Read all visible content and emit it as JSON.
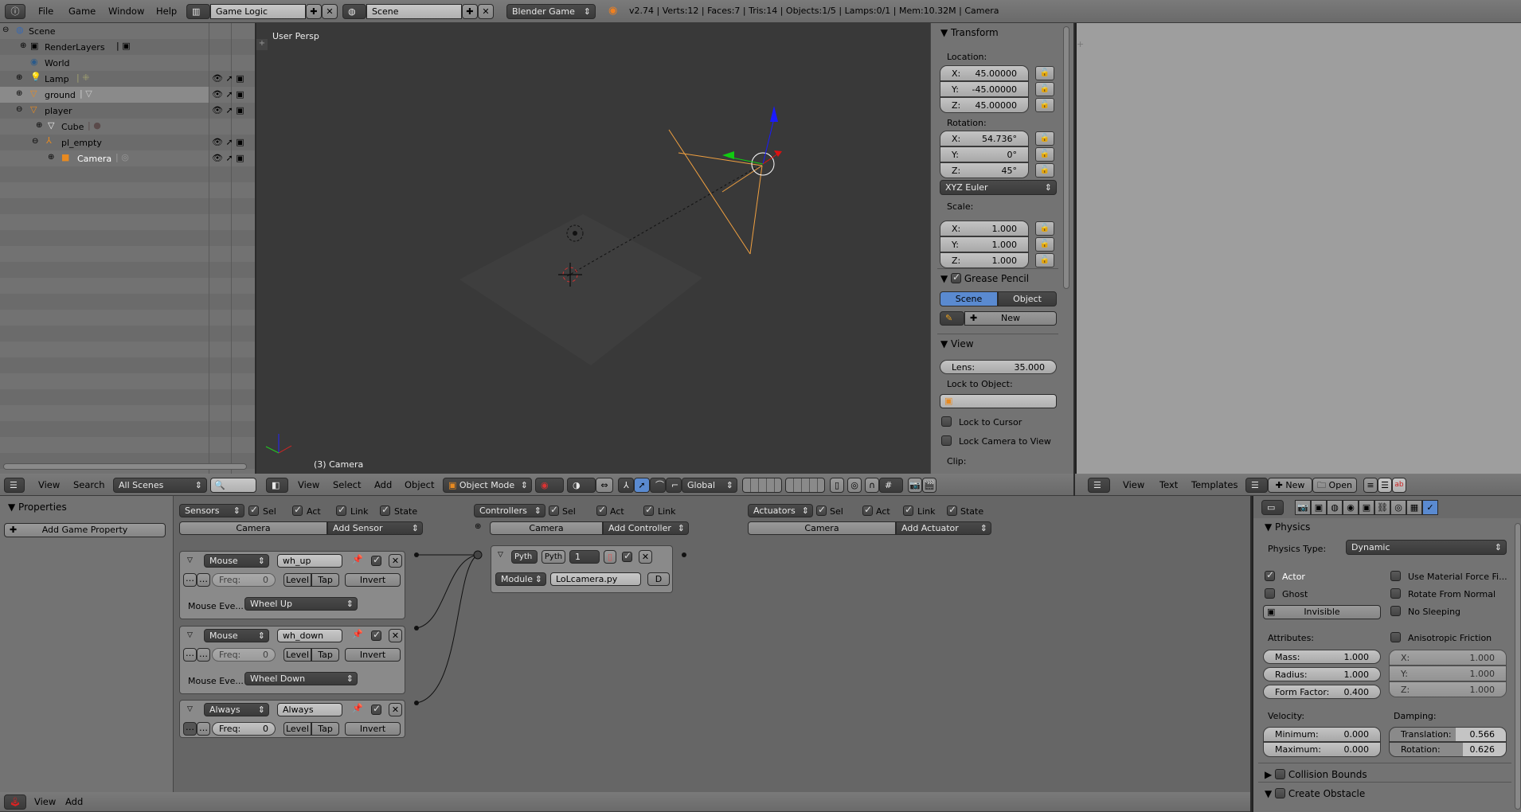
{
  "topbar": {
    "menus": [
      "File",
      "Game",
      "Window",
      "Help"
    ],
    "screen_layout": "Game Logic",
    "scene": "Scene",
    "engine": "Blender Game",
    "stats": "v2.74 | Verts:12 | Faces:7 | Tris:14 | Objects:1/5 | Lamps:0/1 | Mem:10.32M | Camera"
  },
  "outliner": {
    "items": [
      {
        "label": "Scene",
        "icon": "scene-icon"
      },
      {
        "label": "RenderLayers",
        "icon": "renderlayers-icon"
      },
      {
        "label": "World",
        "icon": "world-icon"
      },
      {
        "label": "Lamp",
        "icon": "lamp-icon"
      },
      {
        "label": "ground",
        "icon": "mesh-object-icon"
      },
      {
        "label": "player",
        "icon": "mesh-object-icon"
      },
      {
        "label": "Cube",
        "icon": "mesh-data-icon"
      },
      {
        "label": "pl_empty",
        "icon": "empty-icon"
      },
      {
        "label": "Camera",
        "icon": "camera-icon"
      }
    ],
    "header": {
      "view": "View",
      "search": "Search",
      "filter": "All Scenes"
    }
  },
  "viewport": {
    "label_top": "User Persp",
    "label_bottom": "(3) Camera",
    "header": {
      "view": "View",
      "select": "Select",
      "add": "Add",
      "object": "Object",
      "mode": "Object Mode",
      "orientation": "Global"
    }
  },
  "npanel": {
    "transform": {
      "title": "Transform",
      "location_label": "Location:",
      "location": [
        {
          "axis": "X:",
          "value": "45.00000"
        },
        {
          "axis": "Y:",
          "value": "-45.00000"
        },
        {
          "axis": "Z:",
          "value": "45.00000"
        }
      ],
      "rotation_label": "Rotation:",
      "rotation": [
        {
          "axis": "X:",
          "value": "54.736°"
        },
        {
          "axis": "Y:",
          "value": "0°"
        },
        {
          "axis": "Z:",
          "value": "45°"
        }
      ],
      "rotation_mode": "XYZ Euler",
      "scale_label": "Scale:",
      "scale": [
        {
          "axis": "X:",
          "value": "1.000"
        },
        {
          "axis": "Y:",
          "value": "1.000"
        },
        {
          "axis": "Z:",
          "value": "1.000"
        }
      ]
    },
    "grease_pencil": {
      "title": "Grease Pencil",
      "scene": "Scene",
      "object": "Object",
      "new": "New"
    },
    "view": {
      "title": "View",
      "lens_label": "Lens:",
      "lens": "35.000",
      "lock_to_object": "Lock to Object:",
      "lock_cursor": "Lock to Cursor",
      "lock_camera": "Lock Camera to View",
      "clip": "Clip:"
    }
  },
  "text_editor": {
    "view": "View",
    "text": "Text",
    "templates": "Templates",
    "new": "New",
    "open": "Open"
  },
  "logic": {
    "properties_title": "Properties",
    "add_property": "Add Game Property",
    "sensors_header": {
      "menu": "Sensors",
      "sel": "Sel",
      "act": "Act",
      "link": "Link",
      "state": "State",
      "object": "Camera",
      "add": "Add Sensor"
    },
    "controllers_header": {
      "menu": "Controllers",
      "sel": "Sel",
      "act": "Act",
      "link": "Link",
      "object": "Camera",
      "add": "Add Controller"
    },
    "actuators_header": {
      "menu": "Actuators",
      "sel": "Sel",
      "act": "Act",
      "link": "Link",
      "state": "State",
      "object": "Camera",
      "add": "Add Actuator"
    },
    "sensors": [
      {
        "type": "Mouse",
        "name": "wh_up",
        "freq_label": "Freq:",
        "freq": "0",
        "level": "Level",
        "tap": "Tap",
        "invert": "Invert",
        "event_label": "Mouse Eve...",
        "event": "Wheel Up"
      },
      {
        "type": "Mouse",
        "name": "wh_down",
        "freq_label": "Freq:",
        "freq": "0",
        "level": "Level",
        "tap": "Tap",
        "invert": "Invert",
        "event_label": "Mouse Eve...",
        "event": "Wheel Down"
      },
      {
        "type": "Always",
        "name": "Always",
        "freq_label": "Freq:",
        "freq": "0",
        "level": "Level",
        "tap": "Tap",
        "invert": "Invert"
      }
    ],
    "controller": {
      "type": "Pyth",
      "name": "Pyth",
      "state": "1",
      "mode": "Module",
      "module": "LoLcamera.py",
      "debug": "D"
    },
    "footer": {
      "view": "View",
      "add": "Add"
    }
  },
  "physics": {
    "title": "Physics",
    "type_label": "Physics Type:",
    "type": "Dynamic",
    "actor": "Actor",
    "ghost": "Ghost",
    "invisible": "Invisible",
    "use_material_force": "Use Material Force Fi...",
    "rotate_from_normal": "Rotate From Normal",
    "no_sleeping": "No Sleeping",
    "attributes_label": "Attributes:",
    "mass_label": "Mass:",
    "mass": "1.000",
    "radius_label": "Radius:",
    "radius": "1.000",
    "form_factor_label": "Form Factor:",
    "form_factor": "0.400",
    "aniso_label": "Anisotropic Friction",
    "aniso": [
      {
        "axis": "X:",
        "value": "1.000"
      },
      {
        "axis": "Y:",
        "value": "1.000"
      },
      {
        "axis": "Z:",
        "value": "1.000"
      }
    ],
    "velocity_label": "Velocity:",
    "min_label": "Minimum:",
    "min": "0.000",
    "max_label": "Maximum:",
    "max": "0.000",
    "damping_label": "Damping:",
    "translation_label": "Translation:",
    "translation": "0.566",
    "rotation_label": "Rotation:",
    "rotation": "0.626",
    "collision_bounds": "Collision Bounds",
    "create_obstacle": "Create Obstacle"
  }
}
